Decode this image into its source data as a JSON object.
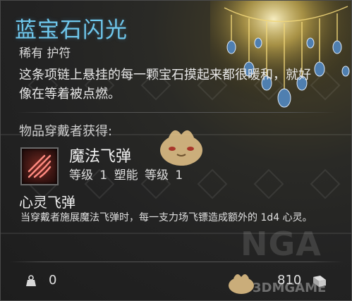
{
  "item": {
    "name": "蓝宝石闪光",
    "rarity_type": "稀有 护符",
    "description": "这条项链上悬挂的每一颗宝石摸起来都很暖和，就好像在等着被点燃。",
    "grants_heading": "物品穿戴者获得:",
    "perk": {
      "name": "魔法飞弹",
      "levels": "等级 1 塑能 等级 1",
      "icon": "magic-missile-icon"
    },
    "spell": {
      "name": "心灵飞弹",
      "description": "当穿戴者施展魔法飞弹时，每一支力场飞镖造成额外的 1d4 心灵。"
    },
    "weight": "0",
    "price": "810"
  },
  "watermarks": {
    "nga": "NGA",
    "site": "3DMGAME"
  },
  "colors": {
    "title": "#6fc7ec",
    "text": "#e8e8e8",
    "background": "#232323"
  }
}
